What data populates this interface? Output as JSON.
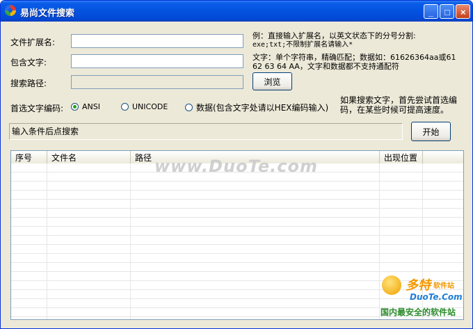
{
  "window": {
    "title": "易尚文件搜索",
    "minimize": "_",
    "maximize": "□",
    "close": "×"
  },
  "form": {
    "ext_label": "文件扩展名:",
    "ext_value": "",
    "text_label": "包含文字:",
    "text_value": "",
    "path_label": "搜索路径:",
    "path_value": "",
    "browse_button": "浏览",
    "encoding_label": "首选文字编码:",
    "encoding_options": [
      "ANSI",
      "UNICODE",
      "数据(包含文字处请以HEX编码输入)"
    ],
    "encoding_selected": "ANSI",
    "start_button": "开始",
    "status_text": "输入条件后点搜索"
  },
  "hints": {
    "ext_hint": [
      "例：直接输入扩展名，以英文状态下的分号分割:",
      "exe;txt;不限制扩展名请输入*"
    ],
    "text_hint": [
      "文字：单个字符串，精确匹配；数据如：61626364aa或61",
      "62 63 64 AA，文字和数据都不支持通配符"
    ],
    "encoding_hint": [
      "如果搜索文字，首先尝试首选编",
      "码，在某些时候可提高速度。"
    ]
  },
  "results_table": {
    "columns": [
      "序号",
      "文件名",
      "路径",
      "出现位置"
    ],
    "rows": []
  },
  "watermark": "www.DuoTe.com",
  "logo": {
    "name": "多特",
    "sub": "软件站",
    "url": "DuoTe.Com",
    "slogan": "国内最安全的软件站"
  }
}
